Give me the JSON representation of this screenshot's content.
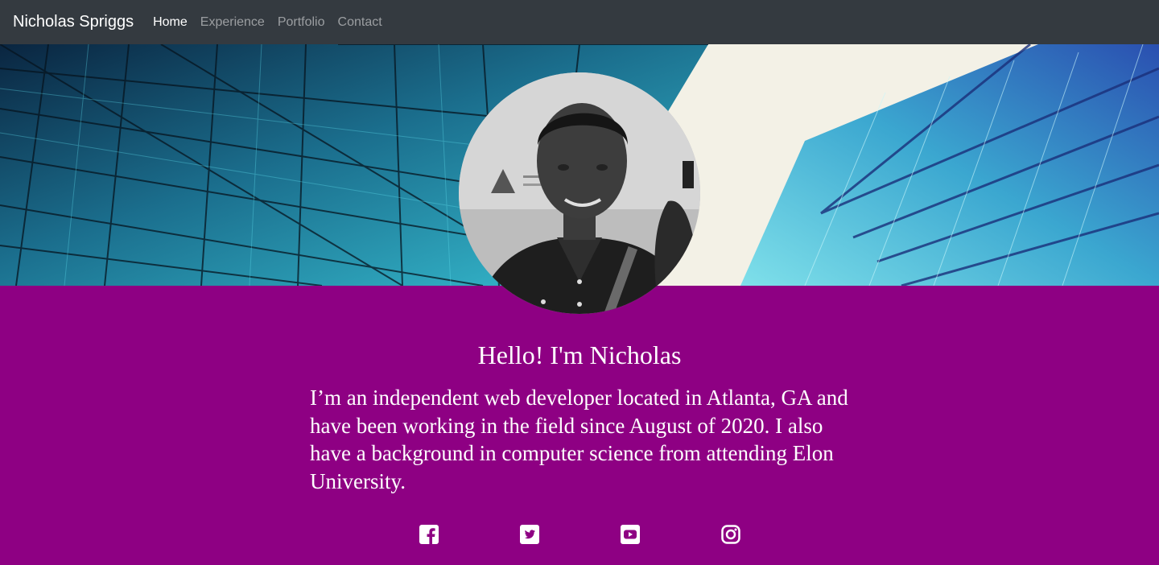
{
  "navbar": {
    "brand": "Nicholas Spriggs",
    "links": [
      {
        "label": "Home",
        "active": true
      },
      {
        "label": "Experience",
        "active": false
      },
      {
        "label": "Portfolio",
        "active": false
      },
      {
        "label": "Contact",
        "active": false
      }
    ]
  },
  "hero": {
    "image": "glass-skyscraper-icon",
    "profile_photo": "avatar-photo"
  },
  "intro": {
    "greeting": "Hello! I'm Nicholas",
    "bio": "I’m an independent web developer located in Atlanta, GA and have been working in the field since August of 2020. I also have a background in computer science from attending Elon University."
  },
  "socials": [
    {
      "icon": "facebook-icon"
    },
    {
      "icon": "twitter-icon"
    },
    {
      "icon": "youtube-icon"
    },
    {
      "icon": "instagram-icon"
    }
  ],
  "colors": {
    "navbar_bg": "#343a40",
    "accent_purple": "#8e0083",
    "text_white": "#ffffff",
    "nav_inactive": "rgba(255,255,255,0.5)"
  }
}
